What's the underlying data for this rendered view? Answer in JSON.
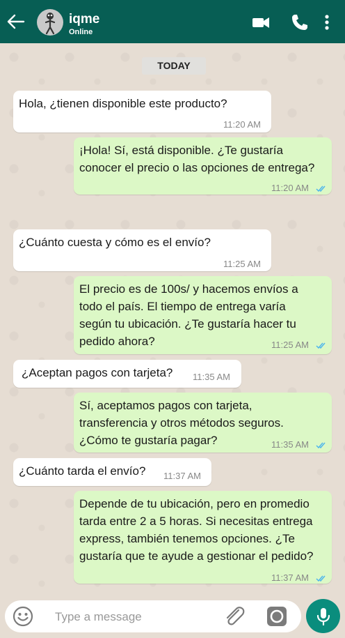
{
  "header": {
    "contact_name": "iqme",
    "status": "Online",
    "icons": [
      "back-arrow-icon",
      "avatar",
      "video-call-icon",
      "phone-icon",
      "more-options-icon"
    ],
    "background_color": "#075e54"
  },
  "chat": {
    "date_label": "TODAY",
    "messages": [
      {
        "direction": "incoming",
        "text": "Hola, ¿tienen disponible este producto?",
        "time": "11:20 AM"
      },
      {
        "direction": "outgoing",
        "text": "¡Hola! Sí, está disponible. ¿Te gustaría\nconocer el precio o las opciones de entrega?",
        "time": "11:20 AM",
        "read": true
      },
      {
        "direction": "incoming",
        "text": "¿Cuánto cuesta y cómo es el envío?",
        "time": "11:25 AM"
      },
      {
        "direction": "outgoing",
        "text": " El precio es de 100s/ y hacemos envíos a\ntodo el país. El tiempo de entrega varía\nsegún tu ubicación. ¿Te gustaría hacer tu\npedido ahora?",
        "time": "11:25 AM",
        "read": true
      },
      {
        "direction": "incoming",
        "text": "¿Aceptan pagos con tarjeta?",
        "time": "11:35 AM"
      },
      {
        "direction": "outgoing",
        "text": "Sí, aceptamos pagos con tarjeta,\ntransferencia y otros métodos seguros.\n¿Cómo te gustaría pagar?",
        "time": "11:35 AM",
        "read": true
      },
      {
        "direction": "incoming",
        "text": "¿Cuánto tarda el envío?",
        "time": "11:37 AM"
      },
      {
        "direction": "outgoing",
        "text": "Depende de tu ubicación, pero en promedio\ntarda entre 2 a 5 horas. Si necesitas entrega\nexpress, también tenemos opciones. ¿Te\ngustaría que te ayude a gestionar el pedido?",
        "time": "11:37 AM",
        "read": true
      }
    ],
    "colors": {
      "incoming_bubble": "#ffffff",
      "outgoing_bubble": "#dcf8c6",
      "read_ticks": "#4fb6ec"
    }
  },
  "composer": {
    "placeholder": "Type a message",
    "icons": [
      "emoji-icon",
      "attach-icon",
      "camera-icon",
      "mic-icon"
    ],
    "send_button_color": "#0a8d7d"
  }
}
